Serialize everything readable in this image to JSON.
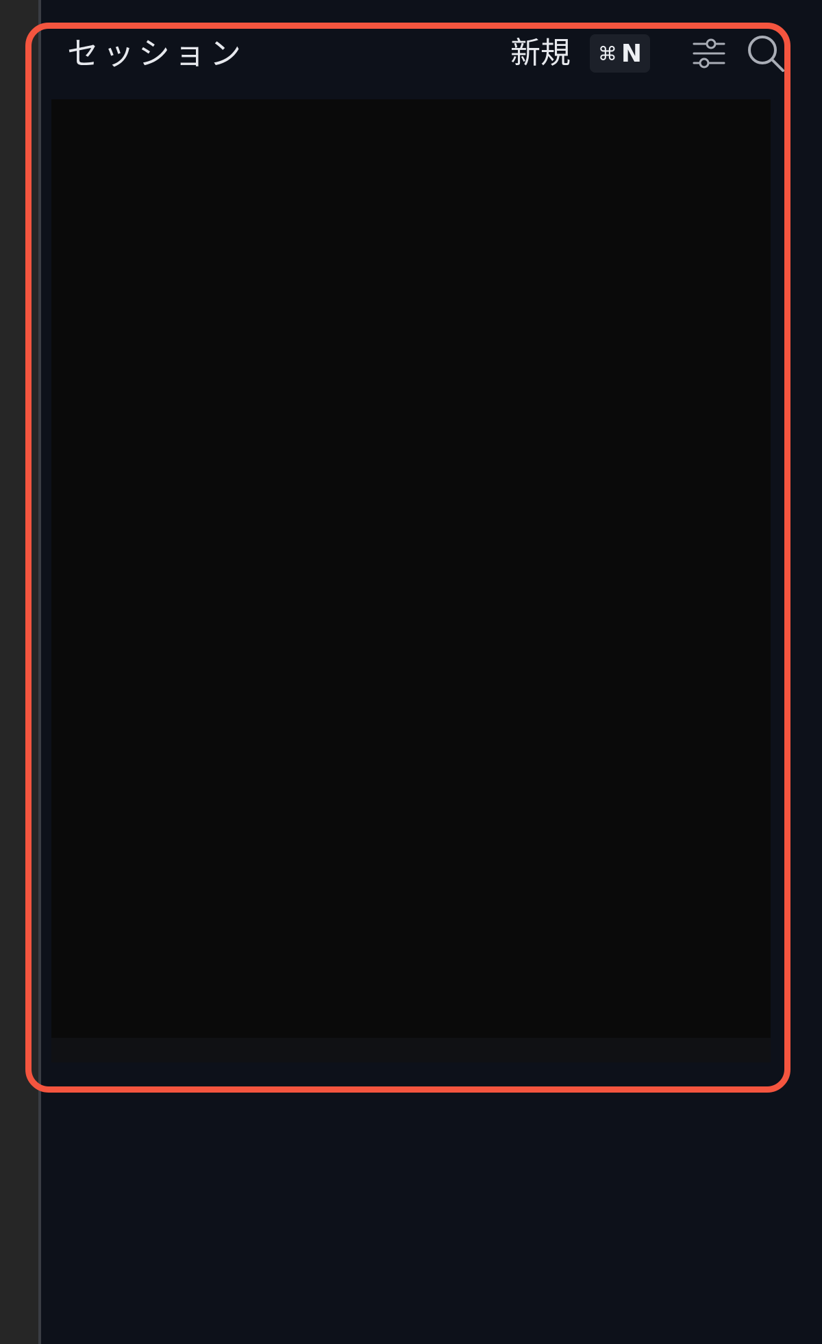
{
  "sessions_panel": {
    "title": "セッション",
    "new_label": "新規",
    "shortcut": {
      "modifier": "⌘",
      "key": "N"
    },
    "filter_icon": "sliders-icon",
    "search_icon": "search-icon"
  },
  "colors": {
    "background": "#0d111a",
    "content_background": "#0a0a0a",
    "highlight": "#f4553f",
    "text": "#e7e9ee"
  }
}
